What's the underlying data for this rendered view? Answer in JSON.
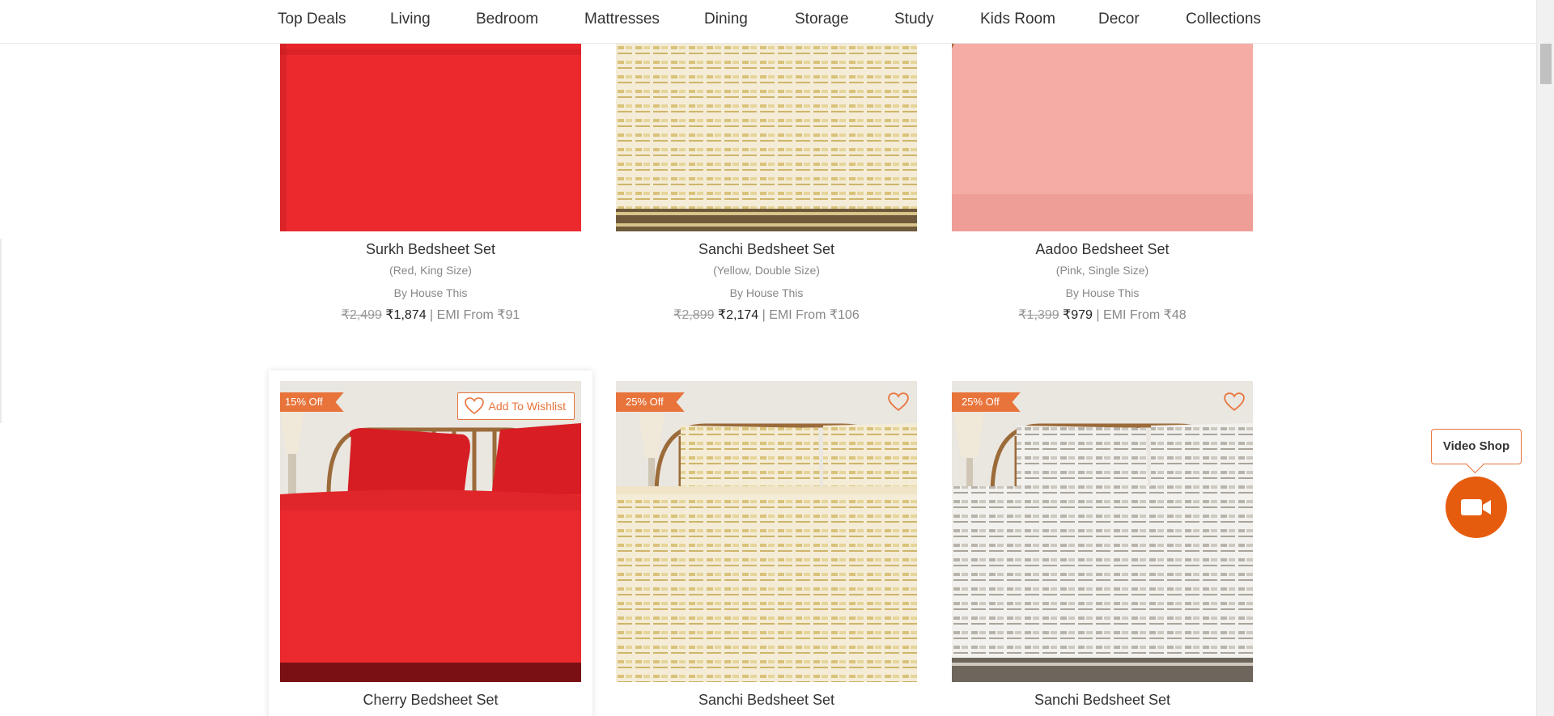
{
  "nav": {
    "items": [
      "Top Deals",
      "Living",
      "Bedroom",
      "Mattresses",
      "Dining",
      "Storage",
      "Study",
      "Kids Room",
      "Decor",
      "Collections"
    ]
  },
  "colors": {
    "accent": "#e8743b",
    "video_button": "#e65c0e"
  },
  "products_row1": [
    {
      "title": "Surkh Bedsheet Set",
      "variant": "(Red, King Size)",
      "brand": "By House This",
      "mrp": "₹2,499",
      "price": "₹1,874",
      "emi": " | EMI From ₹91"
    },
    {
      "title": "Sanchi Bedsheet Set",
      "variant": "(Yellow, Double Size)",
      "brand": "By House This",
      "mrp": "₹2,899",
      "price": "₹2,174",
      "emi": " | EMI From ₹106"
    },
    {
      "title": "Aadoo Bedsheet Set",
      "variant": "(Pink, Single Size)",
      "brand": "By House This",
      "mrp": "₹1,399",
      "price": "₹979",
      "emi": " | EMI From ₹48"
    }
  ],
  "products_row2": [
    {
      "title": "Cherry Bedsheet Set",
      "badge": "15% Off",
      "wishlist_label": "Add To Wishlist"
    },
    {
      "title": "Sanchi Bedsheet Set",
      "badge": "25% Off"
    },
    {
      "title": "Sanchi Bedsheet Set",
      "badge": "25% Off"
    }
  ],
  "video_shop": {
    "label": "Video Shop",
    "icon": "video-camera-icon"
  }
}
